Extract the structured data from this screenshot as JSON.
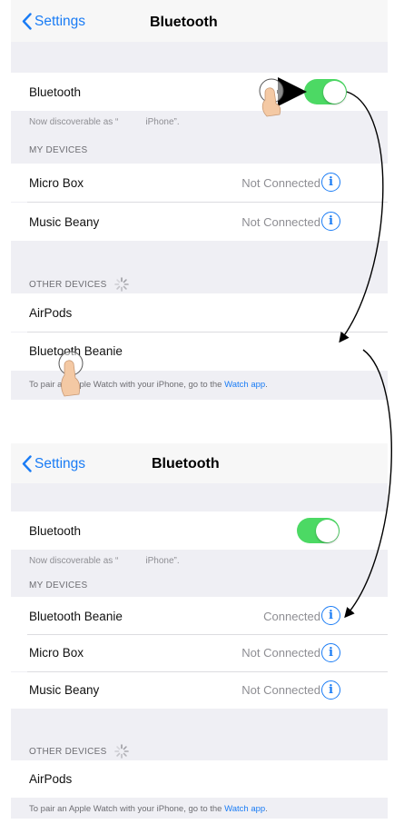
{
  "screens": {
    "before": {
      "nav": {
        "back": "Settings",
        "title": "Bluetooth"
      },
      "bluetooth_label": "Bluetooth",
      "discoverable": {
        "prefix": "Now discoverable as “",
        "suffix": "iPhone”."
      },
      "my_devices_header": "MY DEVICES",
      "my_devices": [
        {
          "name": "Micro Box",
          "status": "Not Connected"
        },
        {
          "name": "Music Beany",
          "status": "Not Connected"
        }
      ],
      "other_devices_header": "OTHER DEVICES",
      "other_devices": [
        "AirPods",
        "Bluetooth Beanie"
      ],
      "footer": {
        "prefix": "To pair an Apple Watch with your iPhone, go to the ",
        "link": "Watch app",
        "suffix": "."
      }
    },
    "after": {
      "nav": {
        "back": "Settings",
        "title": "Bluetooth"
      },
      "bluetooth_label": "Bluetooth",
      "discoverable": {
        "prefix": "Now discoverable as “",
        "suffix": "iPhone”."
      },
      "my_devices_header": "MY DEVICES",
      "my_devices": [
        {
          "name": "Bluetooth Beanie",
          "status": "Connected"
        },
        {
          "name": "Micro Box",
          "status": "Not Connected"
        },
        {
          "name": "Music Beany",
          "status": "Not Connected"
        }
      ],
      "other_devices_header": "OTHER DEVICES",
      "other_devices": [
        "AirPods"
      ],
      "footer": {
        "prefix": "To pair an Apple Watch with your iPhone, go to the ",
        "link": "Watch app",
        "suffix": "."
      }
    }
  },
  "info_glyph": "i",
  "icons": {
    "back": "chevron-left-icon",
    "info": "info-circle-icon",
    "spinner": "activity-spinner-icon",
    "hand": "pointing-hand-icon",
    "arrow": "curved-arrow-icon"
  },
  "colors": {
    "accent": "#1a7cf5",
    "toggle_on": "#4cd964",
    "group_bg": "#efeff4"
  },
  "toggles": {
    "before_bluetooth_on": true,
    "after_bluetooth_on": true
  }
}
